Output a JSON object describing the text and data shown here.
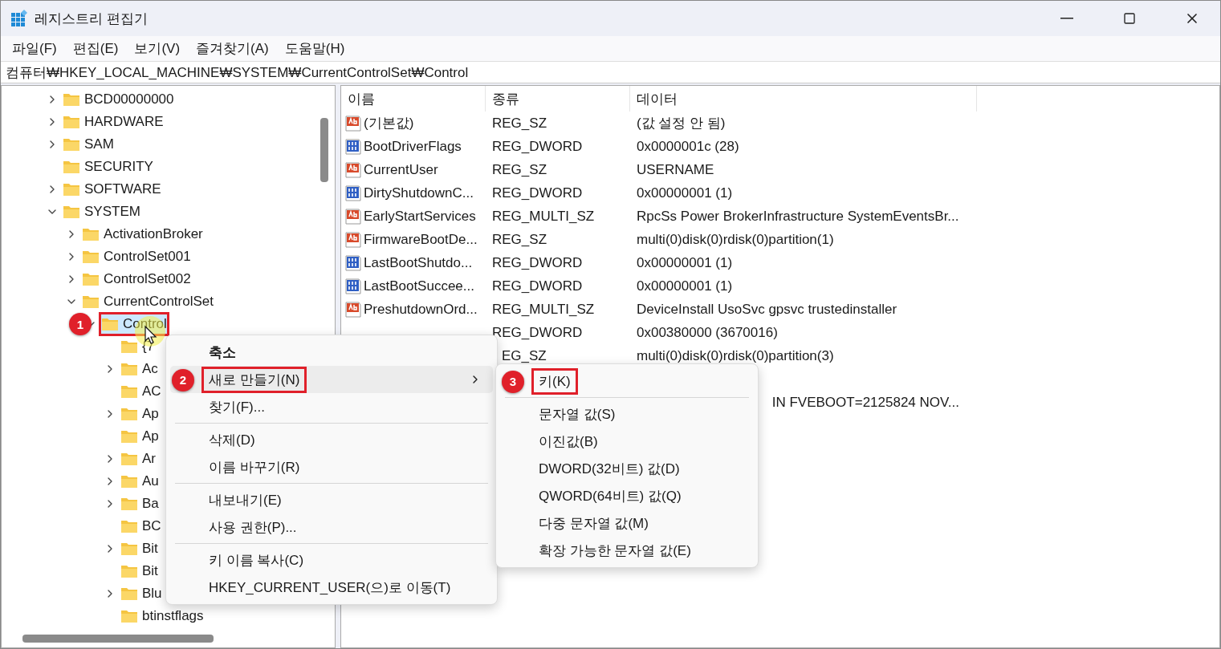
{
  "window": {
    "title": "레지스트리 편집기"
  },
  "menu_bar": [
    "파일(F)",
    "편집(E)",
    "보기(V)",
    "즐겨찾기(A)",
    "도움말(H)"
  ],
  "address": "컴퓨터₩HKEY_LOCAL_MACHINE₩SYSTEM₩CurrentControlSet₩Control",
  "tree": [
    {
      "label": "BCD00000000",
      "has_children": true,
      "expanded": false,
      "selected": false
    },
    {
      "label": "HARDWARE",
      "has_children": true,
      "expanded": false,
      "selected": false
    },
    {
      "label": "SAM",
      "has_children": true,
      "expanded": false,
      "selected": false
    },
    {
      "label": "SECURITY",
      "has_children": false,
      "selected": false
    },
    {
      "label": "SOFTWARE",
      "has_children": true,
      "expanded": false,
      "selected": false
    },
    {
      "label": "SYSTEM",
      "has_children": true,
      "expanded": true,
      "selected": false,
      "children": [
        {
          "label": "ActivationBroker",
          "has_children": true,
          "expanded": false,
          "selected": false
        },
        {
          "label": "ControlSet001",
          "has_children": true,
          "expanded": false,
          "selected": false
        },
        {
          "label": "ControlSet002",
          "has_children": true,
          "expanded": false,
          "selected": false
        },
        {
          "label": "CurrentControlSet",
          "has_children": true,
          "expanded": true,
          "selected": false,
          "children": [
            {
              "label": "Control",
              "has_children": true,
              "expanded": true,
              "selected": true,
              "callout": "1",
              "children": [
                {
                  "label": "{7",
                  "has_children": false,
                  "selected": false
                },
                {
                  "label": "Ac",
                  "has_children": true,
                  "expanded": false,
                  "selected": false
                },
                {
                  "label": "AC",
                  "has_children": false,
                  "selected": false
                },
                {
                  "label": "Ap",
                  "has_children": true,
                  "expanded": false,
                  "selected": false
                },
                {
                  "label": "Ap",
                  "has_children": false,
                  "selected": false
                },
                {
                  "label": "Ar",
                  "has_children": true,
                  "expanded": false,
                  "selected": false
                },
                {
                  "label": "Au",
                  "has_children": true,
                  "expanded": false,
                  "selected": false
                },
                {
                  "label": "Ba",
                  "has_children": true,
                  "expanded": false,
                  "selected": false
                },
                {
                  "label": "BC",
                  "has_children": false,
                  "selected": false
                },
                {
                  "label": "Bit",
                  "has_children": true,
                  "expanded": false,
                  "selected": false
                },
                {
                  "label": "Bit",
                  "has_children": false,
                  "selected": false
                },
                {
                  "label": "Blu",
                  "has_children": true,
                  "expanded": false,
                  "selected": false
                },
                {
                  "label": "btinstflags",
                  "has_children": false,
                  "selected": false
                }
              ]
            }
          ]
        }
      ]
    }
  ],
  "columns": [
    "이름",
    "종류",
    "데이터"
  ],
  "rows": [
    {
      "kind": "string",
      "name": "(기본값)",
      "type": "REG_SZ",
      "data": "(값 설정 안 됨)"
    },
    {
      "kind": "binary",
      "name": "BootDriverFlags",
      "type": "REG_DWORD",
      "data": "0x0000001c (28)"
    },
    {
      "kind": "string",
      "name": "CurrentUser",
      "type": "REG_SZ",
      "data": "USERNAME"
    },
    {
      "kind": "binary",
      "name": "DirtyShutdownC...",
      "type": "REG_DWORD",
      "data": "0x00000001 (1)"
    },
    {
      "kind": "string",
      "name": "EarlyStartServices",
      "type": "REG_MULTI_SZ",
      "data": "RpcSs Power BrokerInfrastructure SystemEventsBr..."
    },
    {
      "kind": "string",
      "name": "FirmwareBootDe...",
      "type": "REG_SZ",
      "data": "multi(0)disk(0)rdisk(0)partition(1)"
    },
    {
      "kind": "binary",
      "name": "LastBootShutdo...",
      "type": "REG_DWORD",
      "data": "0x00000001 (1)"
    },
    {
      "kind": "binary",
      "name": "LastBootSuccee...",
      "type": "REG_DWORD",
      "data": "0x00000001 (1)"
    },
    {
      "kind": "string",
      "name": "PreshutdownOrd...",
      "type": "REG_MULTI_SZ",
      "data": "DeviceInstall UsoSvc gpsvc trustedinstaller"
    },
    {
      "kind": "cut",
      "type": "REG_DWORD",
      "data": "0x00380000 (3670016)"
    },
    {
      "kind": "hidden",
      "type": "EG_SZ",
      "data": "multi(0)disk(0)rdisk(0)partition(3)"
    },
    {
      "kind": "covered"
    },
    {
      "kind": "partial",
      "data": "IN  FVEBOOT=2125824  NOV..."
    }
  ],
  "context_menu": {
    "groups": [
      [
        {
          "label": "축소",
          "bold": true,
          "selected": false,
          "has_submenu": false
        },
        {
          "label": "새로 만들기(N)",
          "bold": false,
          "selected": true,
          "has_submenu": true,
          "callout": "2"
        },
        {
          "label": "찾기(F)...",
          "bold": false,
          "selected": false,
          "has_submenu": false
        }
      ],
      [
        {
          "label": "삭제(D)",
          "bold": false,
          "selected": false,
          "has_submenu": false
        },
        {
          "label": "이름 바꾸기(R)",
          "bold": false,
          "selected": false,
          "has_submenu": false
        }
      ],
      [
        {
          "label": "내보내기(E)",
          "bold": false,
          "selected": false,
          "has_submenu": false
        },
        {
          "label": "사용 권한(P)...",
          "bold": false,
          "selected": false,
          "has_submenu": false
        }
      ],
      [
        {
          "label": "키 이름 복사(C)",
          "bold": false,
          "selected": false,
          "has_submenu": false
        },
        {
          "label": "HKEY_CURRENT_USER(으)로 이동(T)",
          "bold": false,
          "selected": false,
          "has_submenu": false
        }
      ]
    ]
  },
  "submenu": {
    "groups": [
      [
        {
          "label": "키(K)",
          "bold": false,
          "selected": false,
          "has_submenu": false,
          "callout": "3"
        }
      ],
      [
        {
          "label": "문자열 값(S)",
          "bold": false,
          "selected": false,
          "has_submenu": false
        },
        {
          "label": "이진값(B)",
          "bold": false,
          "selected": false,
          "has_submenu": false
        },
        {
          "label": "DWORD(32비트) 값(D)",
          "bold": false,
          "selected": false,
          "has_submenu": false
        },
        {
          "label": "QWORD(64비트) 값(Q)",
          "bold": false,
          "selected": false,
          "has_submenu": false
        },
        {
          "label": "다중 문자열 값(M)",
          "bold": false,
          "selected": false,
          "has_submenu": false
        },
        {
          "label": "확장 가능한 문자열 값(E)",
          "bold": false,
          "selected": false,
          "has_submenu": false
        }
      ]
    ]
  }
}
